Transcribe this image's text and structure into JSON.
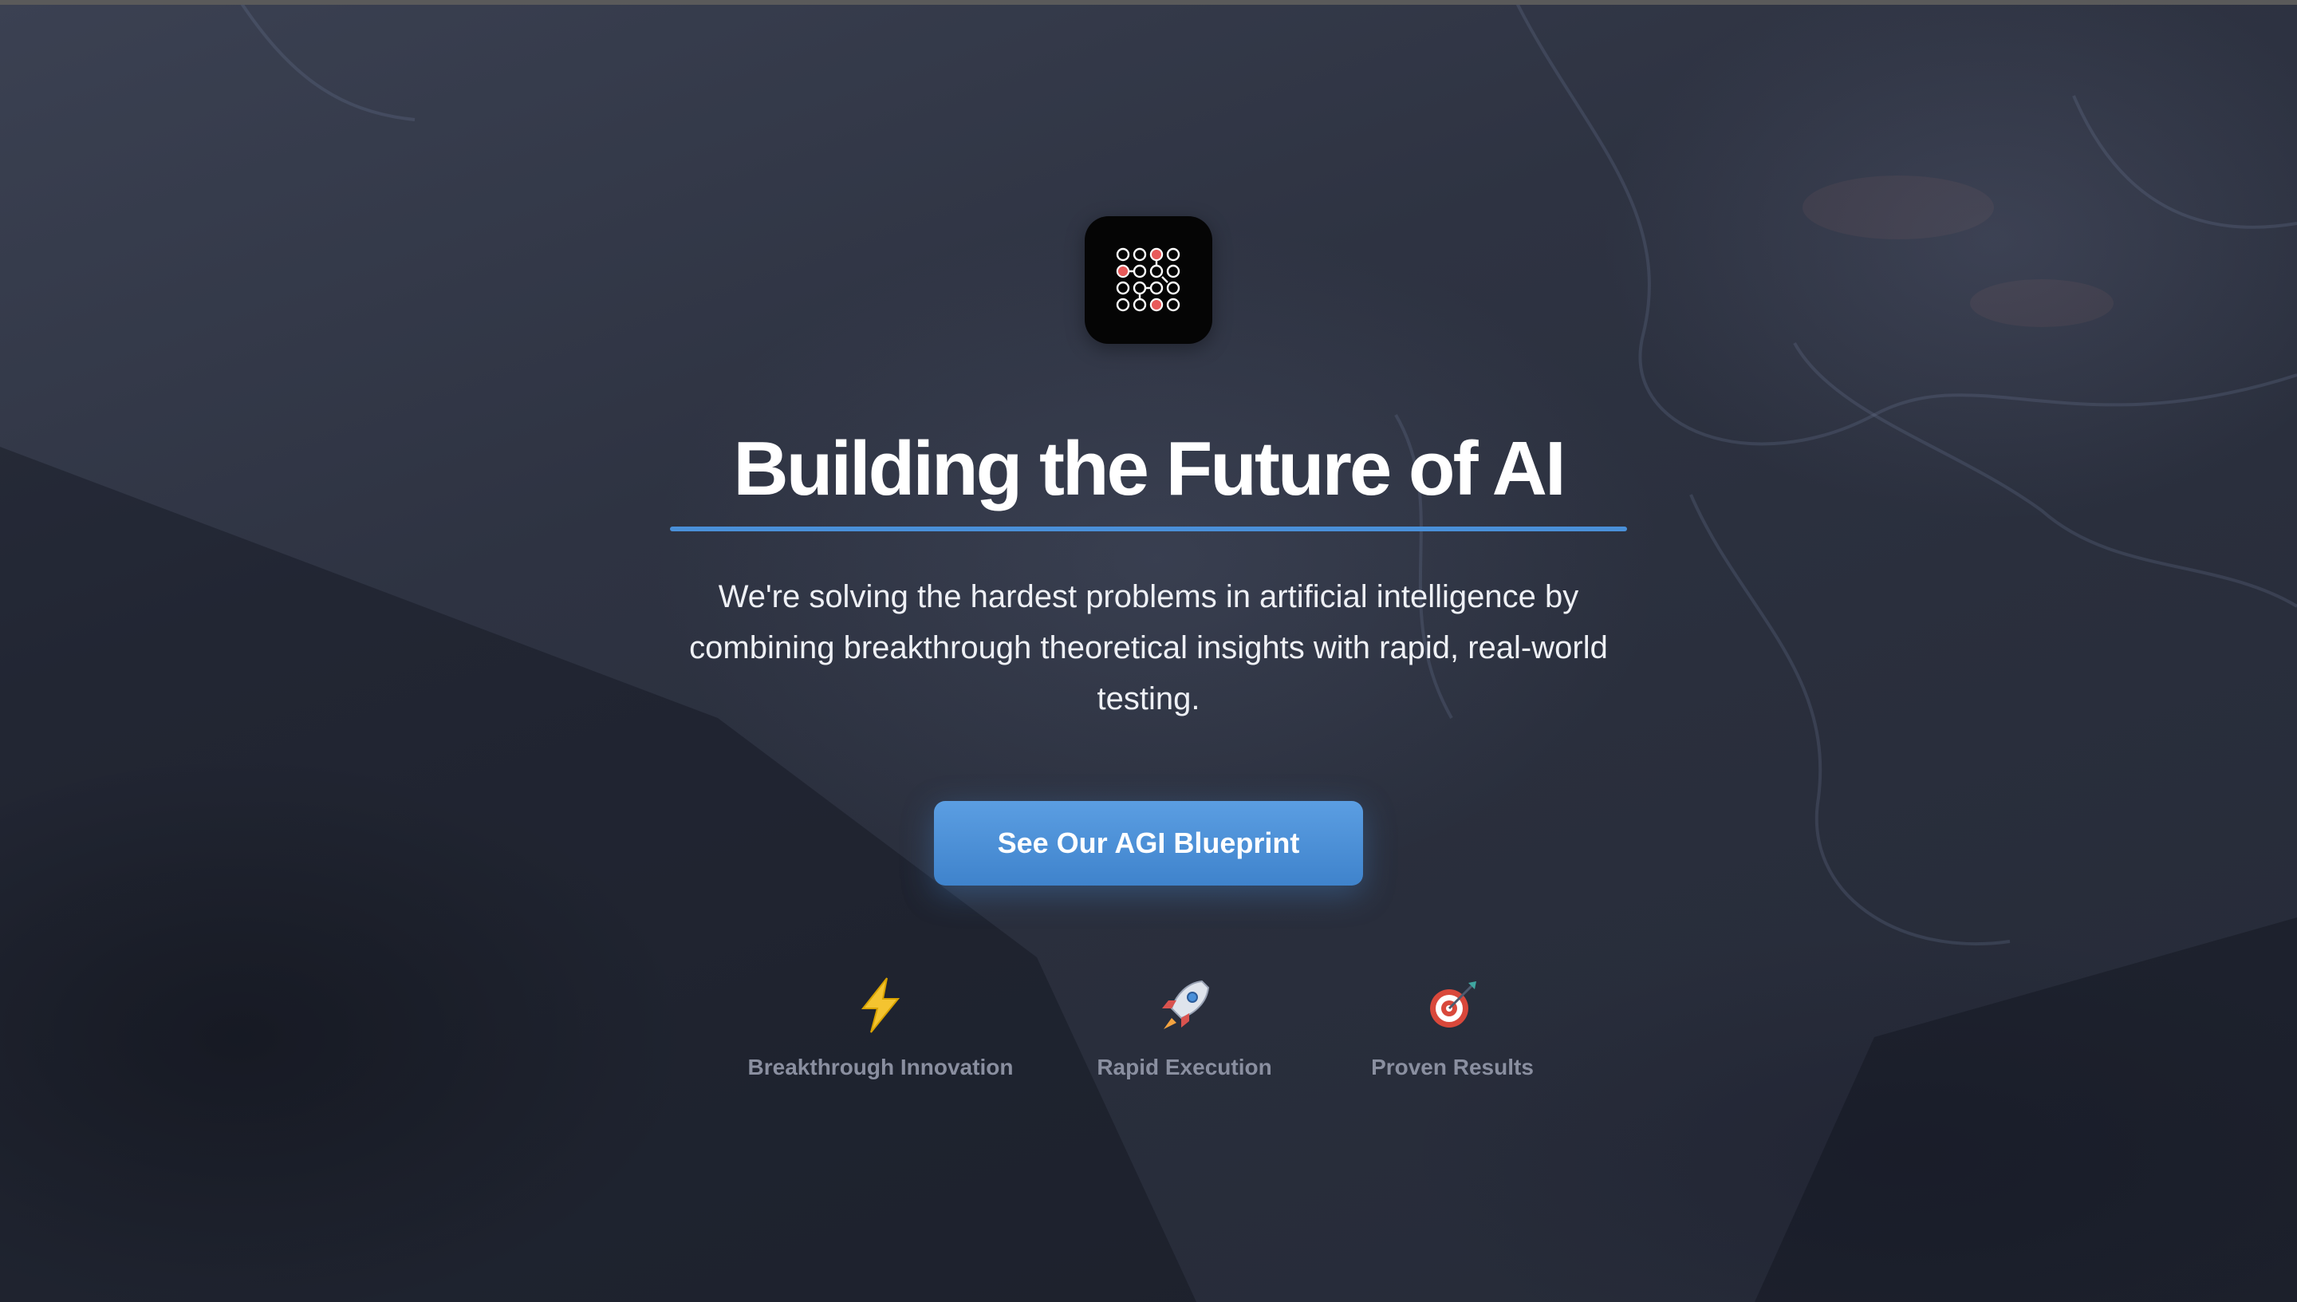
{
  "hero": {
    "title": "Building the Future of AI",
    "subtitle": "We're solving the hardest problems in artificial intelligence by combining breakthrough theoretical insights with rapid, real-world testing.",
    "cta_label": "See Our AGI Blueprint"
  },
  "features": [
    {
      "icon": "lightning-bolt-icon",
      "label": "Breakthrough Innovation"
    },
    {
      "icon": "rocket-icon",
      "label": "Rapid Execution"
    },
    {
      "icon": "target-dart-icon",
      "label": "Proven Results"
    }
  ],
  "colors": {
    "accent": "#4a90d9",
    "background": "#2f3442",
    "logo_background": "#050505",
    "logo_highlight": "#e85a5a",
    "feature_label": "#8a8fa0"
  }
}
